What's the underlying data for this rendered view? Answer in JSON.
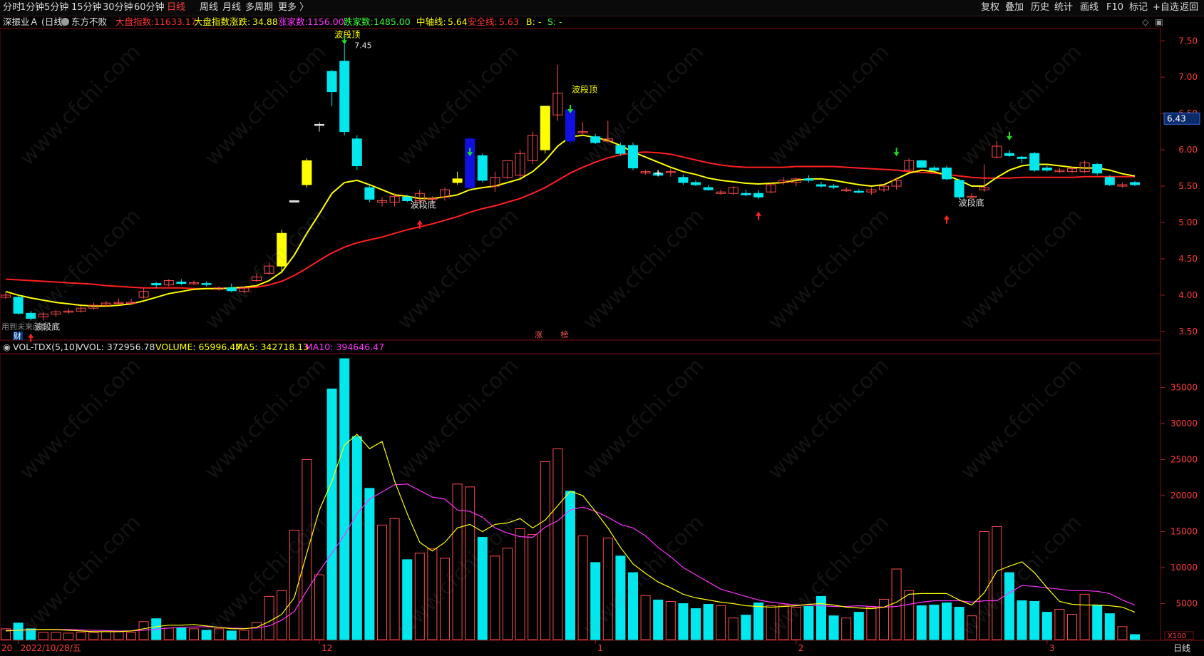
{
  "periods": [
    {
      "label": "分时",
      "active": false
    },
    {
      "label": "1分钟",
      "active": false
    },
    {
      "label": "5分钟",
      "active": false
    },
    {
      "label": "15分钟",
      "active": false
    },
    {
      "label": "30分钟",
      "active": false
    },
    {
      "label": "60分钟",
      "active": false
    },
    {
      "label": "日线",
      "active": true
    },
    {
      "label": "周线",
      "active": false
    },
    {
      "label": "月线",
      "active": false
    },
    {
      "label": "多周期",
      "active": false
    },
    {
      "label": "更多 〉",
      "active": false
    }
  ],
  "tools": [
    "复权",
    "叠加",
    "历史",
    "统计",
    "画线",
    "F10",
    "标记",
    "+自选",
    "返回"
  ],
  "info": {
    "stock": "深振业Ａ (日线)",
    "indicator": "东方不败",
    "idx_label": "大盘指数:",
    "idx_value": "11633.17",
    "chg_label": "大盘指数涨跌:",
    "chg_value": "34.88",
    "up_label": "涨家数:",
    "up_value": "1156.00",
    "down_label": "跌家数:",
    "down_value": "1485.00",
    "mid_label": "中轴线:",
    "mid_value": "5.64",
    "safe_label": "安全线:",
    "safe_value": "5.63",
    "b_label": "B:",
    "b_value": "-",
    "s_label": "S:",
    "s_value": "-"
  },
  "vol_info": {
    "name": "VOL-TDX(5,10)",
    "vvol": "VVOL: 372956.78",
    "volume": "VOLUME: 65996.47",
    "ma5": "MA5: 342718.13",
    "ma10": "MA10: 394646.47"
  },
  "price_box": "6.43",
  "price_axis": [
    "7.50",
    "7.00",
    "6.50",
    "6.00",
    "5.50",
    "5.00",
    "4.50",
    "4.00",
    "3.50"
  ],
  "vol_axis": [
    "35000",
    "30000",
    "25000",
    "20000",
    "15000",
    "10000",
    "5000"
  ],
  "vol_unit": "X100",
  "date_axis": [
    {
      "label": "20",
      "i": 0
    },
    {
      "label": "2022/10/28/五",
      "i": 1
    },
    {
      "label": "12",
      "i": 25
    },
    {
      "label": "1",
      "i": 47
    },
    {
      "label": "2",
      "i": 63
    },
    {
      "label": "3",
      "i": 83
    }
  ],
  "period_label": "日线",
  "wave_top": "波段顶",
  "wave_bottom": "波段底",
  "high_label": "7.45",
  "cai_label": "财",
  "footer_left": "用到未来函数",
  "event_marks": [
    "涨",
    "榜"
  ],
  "colors": {
    "up": "#ff4a4a",
    "down": "#00e8ee",
    "yellow_bar": "#ffff00",
    "blue_bar": "#1010e0",
    "ma_yellow": "#ffff00",
    "ma_red": "#ff2020",
    "ma5_vol": "#ffff00",
    "ma10_vol": "#ff33ff"
  },
  "watermark": "www.cfchi.com",
  "chart_data": {
    "type": "candlestick",
    "ylim": [
      3.4,
      7.65
    ],
    "candles": [
      {
        "o": 3.97,
        "h": 4.05,
        "l": 3.95,
        "c": 4.0,
        "v": 1500
      },
      {
        "o": 3.97,
        "h": 4.0,
        "l": 3.73,
        "c": 3.75,
        "v": 2300
      },
      {
        "o": 3.75,
        "h": 3.78,
        "l": 3.65,
        "c": 3.68,
        "v": 1500
      },
      {
        "o": 3.7,
        "h": 3.76,
        "l": 3.65,
        "c": 3.74,
        "v": 1000
      },
      {
        "o": 3.74,
        "h": 3.8,
        "l": 3.7,
        "c": 3.77,
        "v": 1000
      },
      {
        "o": 3.77,
        "h": 3.82,
        "l": 3.74,
        "c": 3.78,
        "v": 900
      },
      {
        "o": 3.78,
        "h": 3.85,
        "l": 3.76,
        "c": 3.82,
        "v": 1000
      },
      {
        "o": 3.82,
        "h": 3.9,
        "l": 3.8,
        "c": 3.86,
        "v": 1000
      },
      {
        "o": 3.86,
        "h": 3.92,
        "l": 3.84,
        "c": 3.89,
        "v": 1100
      },
      {
        "o": 3.89,
        "h": 3.95,
        "l": 3.86,
        "c": 3.9,
        "v": 1100
      },
      {
        "o": 3.9,
        "h": 3.95,
        "l": 3.88,
        "c": 3.9,
        "v": 1000
      },
      {
        "o": 3.97,
        "h": 4.1,
        "l": 3.95,
        "c": 4.05,
        "v": 2500
      },
      {
        "o": 4.16,
        "h": 4.18,
        "l": 4.1,
        "c": 4.14,
        "v": 2900
      },
      {
        "o": 4.14,
        "h": 4.22,
        "l": 4.12,
        "c": 4.2,
        "v": 1600
      },
      {
        "o": 4.18,
        "h": 4.22,
        "l": 4.14,
        "c": 4.16,
        "v": 1600
      },
      {
        "o": 4.17,
        "h": 4.2,
        "l": 4.14,
        "c": 4.17,
        "v": 1500
      },
      {
        "o": 4.16,
        "h": 4.19,
        "l": 4.12,
        "c": 4.15,
        "v": 1300
      },
      {
        "o": 4.08,
        "h": 4.12,
        "l": 4.06,
        "c": 4.1,
        "v": 1500
      },
      {
        "o": 4.1,
        "h": 4.16,
        "l": 4.04,
        "c": 4.06,
        "v": 1200
      },
      {
        "o": 4.05,
        "h": 4.12,
        "l": 4.03,
        "c": 4.1,
        "v": 1300
      },
      {
        "o": 4.2,
        "h": 4.3,
        "l": 4.18,
        "c": 4.25,
        "v": 2400
      },
      {
        "o": 4.3,
        "h": 4.45,
        "l": 4.28,
        "c": 4.4,
        "v": 6000
      },
      {
        "o": 4.4,
        "h": 4.9,
        "l": 4.3,
        "c": 4.85,
        "v": 6800
      },
      {
        "o": 5.28,
        "h": 5.3,
        "l": 5.28,
        "c": 5.3,
        "v": 15200
      },
      {
        "o": 5.52,
        "h": 5.88,
        "l": 5.48,
        "c": 5.85,
        "v": 25000
      },
      {
        "o": 6.35,
        "h": 6.38,
        "l": 6.25,
        "c": 6.35,
        "v": 9000
      },
      {
        "o": 7.08,
        "h": 7.1,
        "l": 6.6,
        "c": 6.8,
        "v": 34800
      },
      {
        "o": 7.22,
        "h": 7.45,
        "l": 6.2,
        "c": 6.25,
        "v": 39000
      },
      {
        "o": 6.15,
        "h": 6.2,
        "l": 5.72,
        "c": 5.78,
        "v": 28200
      },
      {
        "o": 5.48,
        "h": 5.52,
        "l": 5.28,
        "c": 5.32,
        "v": 21000
      },
      {
        "o": 5.28,
        "h": 5.35,
        "l": 5.22,
        "c": 5.3,
        "v": 15900
      },
      {
        "o": 5.28,
        "h": 5.4,
        "l": 5.22,
        "c": 5.36,
        "v": 16800
      },
      {
        "o": 5.35,
        "h": 5.38,
        "l": 5.28,
        "c": 5.3,
        "v": 11100
      },
      {
        "o": 5.3,
        "h": 5.45,
        "l": 5.25,
        "c": 5.4,
        "v": 12000
      },
      {
        "o": 5.32,
        "h": 5.36,
        "l": 5.26,
        "c": 5.33,
        "v": 12600
      },
      {
        "o": 5.35,
        "h": 5.48,
        "l": 5.3,
        "c": 5.45,
        "v": 11300
      },
      {
        "o": 5.55,
        "h": 5.7,
        "l": 5.52,
        "c": 5.6,
        "v": 21600
      },
      {
        "o": 5.48,
        "h": 6.18,
        "l": 5.45,
        "c": 6.15,
        "v": 21200
      },
      {
        "o": 5.92,
        "h": 5.95,
        "l": 5.55,
        "c": 5.58,
        "v": 14200
      },
      {
        "o": 5.5,
        "h": 5.7,
        "l": 5.42,
        "c": 5.62,
        "v": 11600
      },
      {
        "o": 5.62,
        "h": 5.82,
        "l": 5.6,
        "c": 5.85,
        "v": 12700
      },
      {
        "o": 5.65,
        "h": 6.0,
        "l": 5.62,
        "c": 5.95,
        "v": 15400
      },
      {
        "o": 5.85,
        "h": 6.25,
        "l": 5.8,
        "c": 6.2,
        "v": 14600
      },
      {
        "o": 6.0,
        "h": 6.55,
        "l": 5.95,
        "c": 6.6,
        "v": 24700
      },
      {
        "o": 6.48,
        "h": 7.17,
        "l": 6.4,
        "c": 6.78,
        "v": 26500
      },
      {
        "o": 6.55,
        "h": 6.6,
        "l": 6.07,
        "c": 6.12,
        "v": 20600
      },
      {
        "o": 6.25,
        "h": 6.38,
        "l": 6.2,
        "c": 6.25,
        "v": 14400
      },
      {
        "o": 6.18,
        "h": 6.22,
        "l": 6.08,
        "c": 6.1,
        "v": 10700
      },
      {
        "o": 6.12,
        "h": 6.4,
        "l": 6.1,
        "c": 6.15,
        "v": 14100
      },
      {
        "o": 6.06,
        "h": 6.1,
        "l": 5.92,
        "c": 5.95,
        "v": 11600
      },
      {
        "o": 6.06,
        "h": 6.1,
        "l": 5.72,
        "c": 5.75,
        "v": 9300
      },
      {
        "o": 5.68,
        "h": 5.72,
        "l": 5.66,
        "c": 5.7,
        "v": 6100
      },
      {
        "o": 5.68,
        "h": 5.72,
        "l": 5.63,
        "c": 5.65,
        "v": 5500
      },
      {
        "o": 5.7,
        "h": 5.74,
        "l": 5.63,
        "c": 5.7,
        "v": 5300
      },
      {
        "o": 5.62,
        "h": 5.66,
        "l": 5.52,
        "c": 5.55,
        "v": 5000
      },
      {
        "o": 5.55,
        "h": 5.58,
        "l": 5.5,
        "c": 5.52,
        "v": 4300
      },
      {
        "o": 5.48,
        "h": 5.52,
        "l": 5.44,
        "c": 5.45,
        "v": 4900
      },
      {
        "o": 5.4,
        "h": 5.45,
        "l": 5.38,
        "c": 5.42,
        "v": 4700
      },
      {
        "o": 5.4,
        "h": 5.5,
        "l": 5.38,
        "c": 5.48,
        "v": 3000
      },
      {
        "o": 5.4,
        "h": 5.45,
        "l": 5.36,
        "c": 5.38,
        "v": 3400
      },
      {
        "o": 5.4,
        "h": 5.45,
        "l": 5.32,
        "c": 5.35,
        "v": 5100
      },
      {
        "o": 5.42,
        "h": 5.55,
        "l": 5.4,
        "c": 5.52,
        "v": 4700
      },
      {
        "o": 5.55,
        "h": 5.62,
        "l": 5.52,
        "c": 5.58,
        "v": 4800
      },
      {
        "o": 5.55,
        "h": 5.62,
        "l": 5.5,
        "c": 5.6,
        "v": 4500
      },
      {
        "o": 5.6,
        "h": 5.65,
        "l": 5.55,
        "c": 5.58,
        "v": 4600
      },
      {
        "o": 5.52,
        "h": 5.56,
        "l": 5.48,
        "c": 5.5,
        "v": 6000
      },
      {
        "o": 5.5,
        "h": 5.53,
        "l": 5.46,
        "c": 5.49,
        "v": 3300
      },
      {
        "o": 5.45,
        "h": 5.48,
        "l": 5.42,
        "c": 5.45,
        "v": 3000
      },
      {
        "o": 5.43,
        "h": 5.46,
        "l": 5.4,
        "c": 5.42,
        "v": 3800
      },
      {
        "o": 5.42,
        "h": 5.48,
        "l": 5.38,
        "c": 5.45,
        "v": 4500
      },
      {
        "o": 5.45,
        "h": 5.52,
        "l": 5.42,
        "c": 5.5,
        "v": 5600
      },
      {
        "o": 5.5,
        "h": 5.62,
        "l": 5.45,
        "c": 5.58,
        "v": 9800
      },
      {
        "o": 5.72,
        "h": 5.88,
        "l": 5.7,
        "c": 5.85,
        "v": 6800
      },
      {
        "o": 5.85,
        "h": 5.86,
        "l": 5.75,
        "c": 5.76,
        "v": 4700
      },
      {
        "o": 5.75,
        "h": 5.78,
        "l": 5.7,
        "c": 5.72,
        "v": 4800
      },
      {
        "o": 5.75,
        "h": 5.78,
        "l": 5.58,
        "c": 5.6,
        "v": 5100
      },
      {
        "o": 5.58,
        "h": 5.6,
        "l": 5.32,
        "c": 5.35,
        "v": 4500
      },
      {
        "o": 5.35,
        "h": 5.4,
        "l": 5.33,
        "c": 5.36,
        "v": 3300
      },
      {
        "o": 5.45,
        "h": 5.8,
        "l": 5.42,
        "c": 5.48,
        "v": 15000
      },
      {
        "o": 5.9,
        "h": 6.12,
        "l": 5.88,
        "c": 6.05,
        "v": 15700
      },
      {
        "o": 5.95,
        "h": 6.0,
        "l": 5.9,
        "c": 5.92,
        "v": 9300
      },
      {
        "o": 5.9,
        "h": 5.92,
        "l": 5.82,
        "c": 5.88,
        "v": 5400
      },
      {
        "o": 5.95,
        "h": 5.97,
        "l": 5.7,
        "c": 5.72,
        "v": 5300
      },
      {
        "o": 5.75,
        "h": 5.78,
        "l": 5.7,
        "c": 5.72,
        "v": 3800
      },
      {
        "o": 5.7,
        "h": 5.75,
        "l": 5.68,
        "c": 5.72,
        "v": 4200
      },
      {
        "o": 5.7,
        "h": 5.76,
        "l": 5.68,
        "c": 5.74,
        "v": 3500
      },
      {
        "o": 5.7,
        "h": 5.85,
        "l": 5.68,
        "c": 5.82,
        "v": 6300
      },
      {
        "o": 5.8,
        "h": 5.82,
        "l": 5.65,
        "c": 5.68,
        "v": 4800
      },
      {
        "o": 5.62,
        "h": 5.65,
        "l": 5.5,
        "c": 5.52,
        "v": 3600
      },
      {
        "o": 5.5,
        "h": 5.55,
        "l": 5.48,
        "c": 5.52,
        "v": 1800
      },
      {
        "o": 5.55,
        "h": 5.57,
        "l": 5.5,
        "c": 5.52,
        "v": 700
      }
    ],
    "ma_short": [
      4.05,
      4.0,
      3.96,
      3.93,
      3.9,
      3.88,
      3.86,
      3.85,
      3.85,
      3.86,
      3.88,
      3.92,
      3.97,
      4.02,
      4.05,
      4.08,
      4.09,
      4.09,
      4.1,
      4.11,
      4.13,
      4.2,
      4.32,
      4.55,
      4.85,
      5.12,
      5.4,
      5.55,
      5.58,
      5.52,
      5.45,
      5.38,
      5.36,
      5.33,
      5.33,
      5.35,
      5.38,
      5.45,
      5.48,
      5.5,
      5.55,
      5.6,
      5.7,
      5.85,
      6.05,
      6.18,
      6.2,
      6.17,
      6.13,
      6.06,
      5.97,
      5.9,
      5.83,
      5.76,
      5.7,
      5.66,
      5.61,
      5.58,
      5.56,
      5.54,
      5.53,
      5.54,
      5.55,
      5.58,
      5.6,
      5.6,
      5.58,
      5.55,
      5.52,
      5.5,
      5.52,
      5.6,
      5.68,
      5.72,
      5.7,
      5.65,
      5.58,
      5.5,
      5.5,
      5.62,
      5.72,
      5.78,
      5.8,
      5.8,
      5.78,
      5.76,
      5.75,
      5.75,
      5.72,
      5.67,
      5.64
    ],
    "ma_long": [
      4.22,
      4.21,
      4.2,
      4.19,
      4.18,
      4.17,
      4.16,
      4.15,
      4.13,
      4.12,
      4.11,
      4.1,
      4.1,
      4.1,
      4.1,
      4.09,
      4.09,
      4.09,
      4.09,
      4.1,
      4.11,
      4.14,
      4.19,
      4.27,
      4.37,
      4.48,
      4.58,
      4.66,
      4.72,
      4.76,
      4.8,
      4.85,
      4.9,
      4.94,
      4.98,
      5.03,
      5.08,
      5.14,
      5.19,
      5.23,
      5.28,
      5.33,
      5.4,
      5.48,
      5.58,
      5.68,
      5.76,
      5.83,
      5.89,
      5.93,
      5.96,
      5.97,
      5.96,
      5.94,
      5.9,
      5.86,
      5.82,
      5.79,
      5.77,
      5.76,
      5.76,
      5.76,
      5.76,
      5.77,
      5.77,
      5.77,
      5.77,
      5.76,
      5.75,
      5.74,
      5.73,
      5.72,
      5.7,
      5.69,
      5.68,
      5.66,
      5.64,
      5.62,
      5.61,
      5.61,
      5.61,
      5.62,
      5.62,
      5.62,
      5.62,
      5.62,
      5.63,
      5.63,
      5.63,
      5.63,
      5.63
    ],
    "vol_ylim": [
      0,
      39500
    ],
    "vol_ma5": [
      1200,
      1300,
      1400,
      1400,
      1400,
      1300,
      1200,
      1100,
      1100,
      1100,
      1200,
      1500,
      1800,
      2000,
      2000,
      2100,
      1900,
      1700,
      1500,
      1500,
      1700,
      2500,
      3500,
      5800,
      12000,
      18000,
      22000,
      27000,
      28500,
      26500,
      27500,
      22000,
      17500,
      13500,
      12300,
      13500,
      15500,
      16000,
      15000,
      16000,
      16200,
      16800,
      15500,
      16600,
      18600,
      20600,
      20000,
      17800,
      15500,
      12800,
      10500,
      9200,
      8000,
      7200,
      6300,
      5800,
      5500,
      5200,
      5000,
      4700,
      4600,
      4500,
      4600,
      4700,
      4900,
      5000,
      4800,
      4500,
      4400,
      4300,
      4500,
      5200,
      6300,
      6400,
      6400,
      6400,
      5500,
      4800,
      6500,
      9500,
      10200,
      10800,
      9300,
      7200,
      5300,
      4900,
      4800,
      4800,
      4700,
      4500,
      3800
    ],
    "vol_ma10": [
      1300,
      1300,
      1350,
      1400,
      1400,
      1400,
      1350,
      1300,
      1250,
      1200,
      1200,
      1300,
      1450,
      1600,
      1700,
      1750,
      1800,
      1700,
      1600,
      1550,
      1600,
      1900,
      2700,
      3900,
      6800,
      9500,
      12000,
      14500,
      17500,
      19500,
      20500,
      21500,
      21600,
      20700,
      19800,
      19500,
      18000,
      17800,
      17000,
      15500,
      14800,
      14300,
      14200,
      15600,
      16500,
      18000,
      18400,
      17800,
      17000,
      16000,
      15500,
      14400,
      12800,
      11500,
      10000,
      9000,
      8000,
      7000,
      6500,
      6000,
      5500,
      5200,
      5000,
      4800,
      4800,
      4700,
      4600,
      4600,
      4700,
      4600,
      4500,
      4600,
      4900,
      5200,
      5400,
      5400,
      5400,
      5200,
      5400,
      5400,
      6500,
      7500,
      7400,
      7200,
      7000,
      6800,
      6800,
      6700,
      6400,
      5500,
      4800
    ]
  }
}
